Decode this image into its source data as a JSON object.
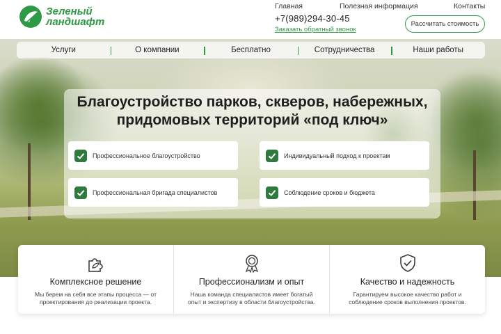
{
  "header": {
    "logo_line1": "Зеленый",
    "logo_line2": "ландшафт",
    "nav": [
      "Главная",
      "Полезная информация",
      "Контакты"
    ],
    "phone": "+7(989)294-30-45",
    "callback": "Заказать обратный звонок",
    "cta": "Рассчитать стоимость"
  },
  "menu": [
    "Услуги",
    "О компании",
    "Бесплатно",
    "Сотрудничества",
    "Наши работы"
  ],
  "hero": {
    "title_line1": "Благоустройство парков, скверов, набережных,",
    "title_line2": "придомовых территорий «под ключ»",
    "features": [
      "Профессиональное благоустройство",
      "Индивидуальный подход к проектам",
      "Профессиональная бригада специалистов",
      "Соблюдение сроков и бюджета"
    ]
  },
  "cards": [
    {
      "icon": "puzzle-leaf-icon",
      "title": "Комплексное решение",
      "text1": "Мы берем на себя все этапы процесса — от",
      "text2": "проектирования до реализации проекта."
    },
    {
      "icon": "award-medal-icon",
      "title": "Профессионализм и опыт",
      "text1": "Наша команда специалистов имеет богатый",
      "text2": "опыт и экспертизу в области благоустройства."
    },
    {
      "icon": "shield-check-icon",
      "title": "Качество и надежность",
      "text1": "Гарантируем высокое качество работ и",
      "text2": "соблюдение сроков выполнения проектов."
    }
  ],
  "colors": {
    "brand_green": "#2f9a45",
    "check_green": "#2f7a3f"
  }
}
